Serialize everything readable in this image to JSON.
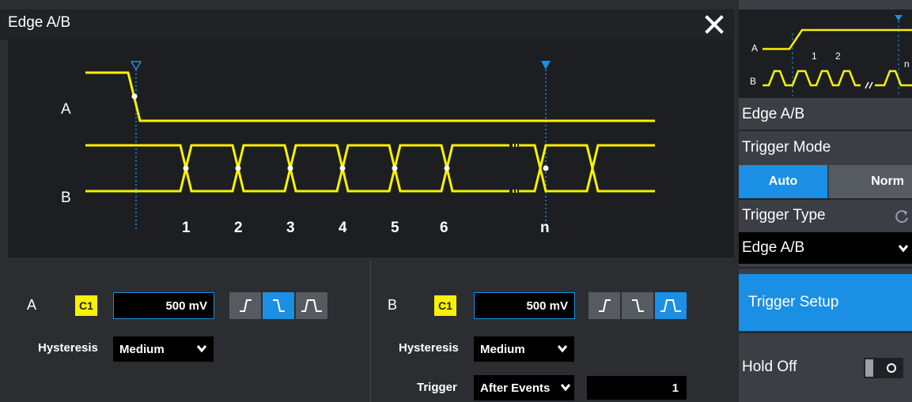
{
  "dialog": {
    "title": "Edge A/B",
    "close_icon": "close-x-icon"
  },
  "waveform": {
    "label_a": "A",
    "label_b": "B",
    "event_numbers": [
      "1",
      "2",
      "3",
      "4",
      "5",
      "6",
      "n"
    ],
    "signal_color": "#f7f200",
    "marker_color": "#1a8fe3"
  },
  "source_a": {
    "label": "A",
    "channel": "C1",
    "level": "500 mV",
    "hysteresis_label": "Hysteresis",
    "hysteresis_value": "Medium",
    "slopes": [
      "rising-edge-icon",
      "falling-edge-icon",
      "either-edge-icon"
    ],
    "active_slope": "falling"
  },
  "source_b": {
    "label": "B",
    "channel": "C1",
    "level": "500 mV",
    "hysteresis_label": "Hysteresis",
    "hysteresis_value": "Medium",
    "trigger_label": "Trigger",
    "trigger_value": "After Events",
    "events_count": "1",
    "slopes": [
      "rising-edge-icon",
      "falling-edge-icon",
      "either-edge-icon"
    ],
    "active_slope": "either"
  },
  "panel": {
    "thumb": {
      "label_a": "A",
      "label_b": "B",
      "num_1": "1",
      "num_2": "2",
      "num_n": "n"
    },
    "title": "Edge A/B",
    "trigger_mode_label": "Trigger Mode",
    "mode_auto": "Auto",
    "mode_norm": "Norm",
    "active_mode": "Auto",
    "trigger_type_label": "Trigger Type",
    "trigger_type_value": "Edge A/B",
    "setup_button": "Trigger Setup",
    "holdoff_label": "Hold Off",
    "holdoff_state": "off"
  }
}
